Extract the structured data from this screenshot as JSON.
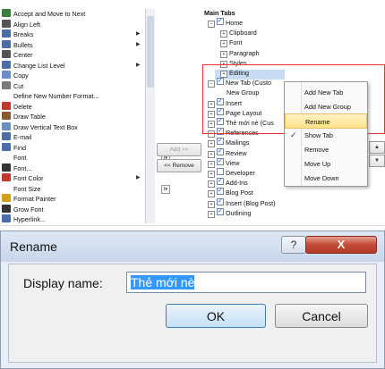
{
  "commands": [
    {
      "label": "Accept and Move to Next",
      "icon": "accept-next-icon",
      "color": "#3b7d3b"
    },
    {
      "label": "Align Left",
      "icon": "align-left-icon",
      "color": "#555"
    },
    {
      "label": "Breaks",
      "icon": "breaks-icon",
      "color": "#4b6ea9",
      "arrow": true
    },
    {
      "label": "Bullets",
      "icon": "bullets-icon",
      "color": "#4b6ea9",
      "arrow": true
    },
    {
      "label": "Center",
      "icon": "center-icon",
      "color": "#555"
    },
    {
      "label": "Change List Level",
      "icon": "list-level-icon",
      "color": "#4b6ea9",
      "arrow": true
    },
    {
      "label": "Copy",
      "icon": "copy-icon",
      "color": "#6b8fc4"
    },
    {
      "label": "Cut",
      "icon": "cut-icon",
      "color": "#7a7a7a"
    },
    {
      "label": "Define New Number Format...",
      "icon": "",
      "color": ""
    },
    {
      "label": "Delete",
      "icon": "delete-icon",
      "color": "#c0392b"
    },
    {
      "label": "Draw Table",
      "icon": "draw-table-icon",
      "color": "#8a5a2b"
    },
    {
      "label": "Draw Vertical Text Box",
      "icon": "text-box-icon",
      "color": "#6b8fc4"
    },
    {
      "label": "E-mail",
      "icon": "email-icon",
      "color": "#4b6ea9"
    },
    {
      "label": "Find",
      "icon": "find-icon",
      "color": "#4b6ea9"
    },
    {
      "label": "Font",
      "icon": "",
      "color": "",
      "dropdown": true
    },
    {
      "label": "Font...",
      "icon": "font-dialog-icon",
      "color": "#333"
    },
    {
      "label": "Font Color",
      "icon": "font-color-icon",
      "color": "#c0392b",
      "arrow": true
    },
    {
      "label": "Font Size",
      "icon": "",
      "color": "",
      "dropdown": true
    },
    {
      "label": "Format Painter",
      "icon": "format-painter-icon",
      "color": "#d4a017"
    },
    {
      "label": "Grow Font",
      "icon": "grow-font-icon",
      "color": "#333"
    },
    {
      "label": "Hyperlink...",
      "icon": "hyperlink-icon",
      "color": "#4b6ea9"
    }
  ],
  "add_button": "Add >>",
  "remove_button": "<< Remove",
  "tabs_header": "Main Tabs",
  "tabs": [
    {
      "label": "Home",
      "indent": 0,
      "exp": "⊟",
      "cb": true
    },
    {
      "label": "Clipboard",
      "indent": 2,
      "exp": "⊞",
      "cb": null
    },
    {
      "label": "Font",
      "indent": 2,
      "exp": "⊞",
      "cb": null
    },
    {
      "label": "Paragraph",
      "indent": 2,
      "exp": "⊞",
      "cb": null
    },
    {
      "label": "Styles",
      "indent": 2,
      "exp": "⊞",
      "cb": null
    },
    {
      "label": "Editing",
      "indent": 2,
      "exp": "⊞",
      "cb": null
    },
    {
      "label": "New Tab (Custo",
      "indent": 0,
      "exp": "⊟",
      "cb": true
    },
    {
      "label": "New Group",
      "indent": 3,
      "exp": "",
      "cb": null
    },
    {
      "label": "Insert",
      "indent": 0,
      "exp": "⊞",
      "cb": true
    },
    {
      "label": "Page Layout",
      "indent": 0,
      "exp": "⊞",
      "cb": true
    },
    {
      "label": "Thẻ mới nè (Cus",
      "indent": 0,
      "exp": "⊞",
      "cb": true
    },
    {
      "label": "References",
      "indent": 0,
      "exp": "⊞",
      "cb": true
    },
    {
      "label": "Mailings",
      "indent": 0,
      "exp": "⊞",
      "cb": true
    },
    {
      "label": "Review",
      "indent": 0,
      "exp": "⊞",
      "cb": true
    },
    {
      "label": "View",
      "indent": 0,
      "exp": "⊞",
      "cb": true
    },
    {
      "label": "Developer",
      "indent": 0,
      "exp": "⊞",
      "cb": false
    },
    {
      "label": "Add-Ins",
      "indent": 0,
      "exp": "⊞",
      "cb": true
    },
    {
      "label": "Blog Post",
      "indent": 0,
      "exp": "⊞",
      "cb": true
    },
    {
      "label": "Insert (Blog Post)",
      "indent": 0,
      "exp": "⊞",
      "cb": true
    },
    {
      "label": "Outlining",
      "indent": 0,
      "exp": "⊞",
      "cb": true
    }
  ],
  "context_menu": [
    {
      "label": "Add New Tab",
      "highlight": false,
      "check": false
    },
    {
      "label": "Add New Group",
      "highlight": false,
      "check": false
    },
    {
      "label": "Rename",
      "highlight": true,
      "check": false
    },
    {
      "label": "Show Tab",
      "highlight": false,
      "check": true
    },
    {
      "label": "Remove",
      "highlight": false,
      "check": false
    },
    {
      "label": "Move Up",
      "highlight": false,
      "check": false
    },
    {
      "label": "Move Down",
      "highlight": false,
      "check": false
    }
  ],
  "dialog": {
    "title": "Rename",
    "help_glyph": "?",
    "close_glyph": "X",
    "label": "Display name:",
    "value": "Thẻ mới nè",
    "ok": "OK",
    "cancel": "Cancel"
  }
}
